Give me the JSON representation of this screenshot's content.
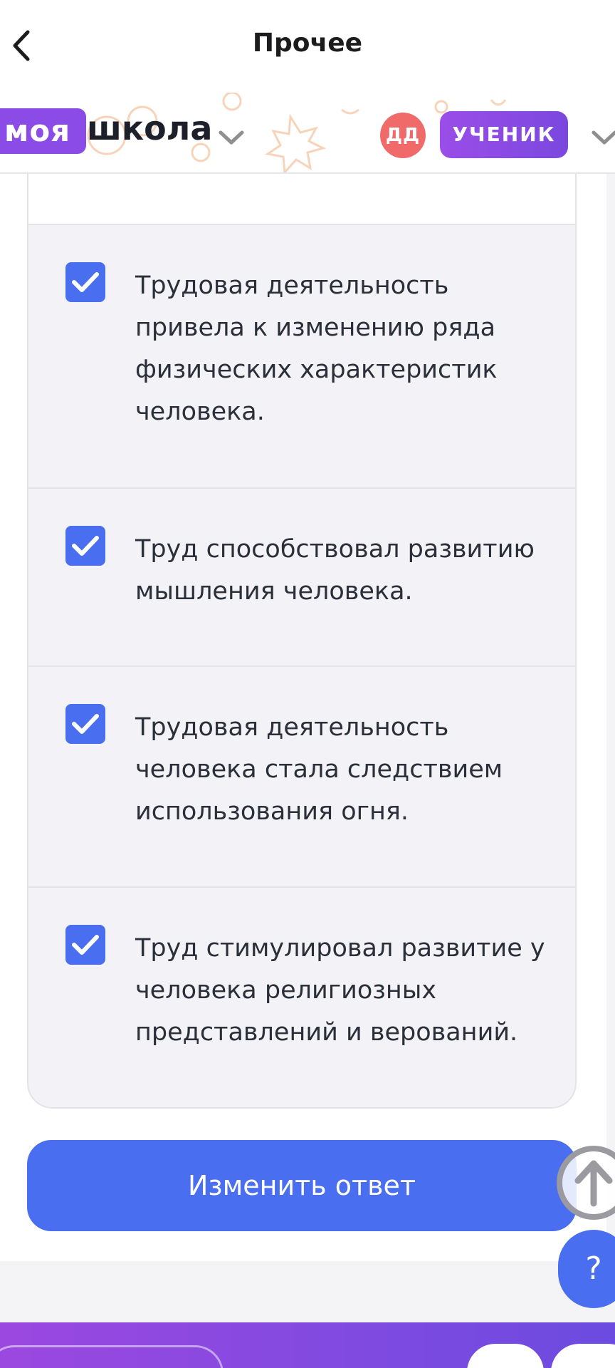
{
  "header": {
    "title": "Прочее"
  },
  "brand": {
    "part1": "моя",
    "part2": "школа",
    "accent_color": "#8a4be6"
  },
  "user": {
    "initials": "ДД",
    "role": "УЧЕНИК",
    "avatar_color": "#f06a6a"
  },
  "answers": [
    {
      "checked": true,
      "text": "Трудовая деятельность привела к изменению ряда физических характеристик человека."
    },
    {
      "checked": true,
      "text": "Труд способствовал развитию мышления человека."
    },
    {
      "checked": true,
      "text": "Трудовая деятельность человека стала следствием использования огня."
    },
    {
      "checked": true,
      "text": "Труд стимулировал развитие у человека религиозных представлений и верований."
    }
  ],
  "actions": {
    "change_answer": "Изменить ответ",
    "help": "?"
  },
  "colors": {
    "primary": "#4a6ef0",
    "checkbox": "#4a6ef0",
    "bottom_bar_start": "#9b48e0",
    "bottom_bar_end": "#6c4be0"
  },
  "icons": {
    "back": "chevron-left-icon",
    "brand_menu": "chevron-down-icon",
    "role_menu": "chevron-down-icon",
    "check": "checkmark-icon",
    "scroll_top": "arrow-up-icon"
  }
}
